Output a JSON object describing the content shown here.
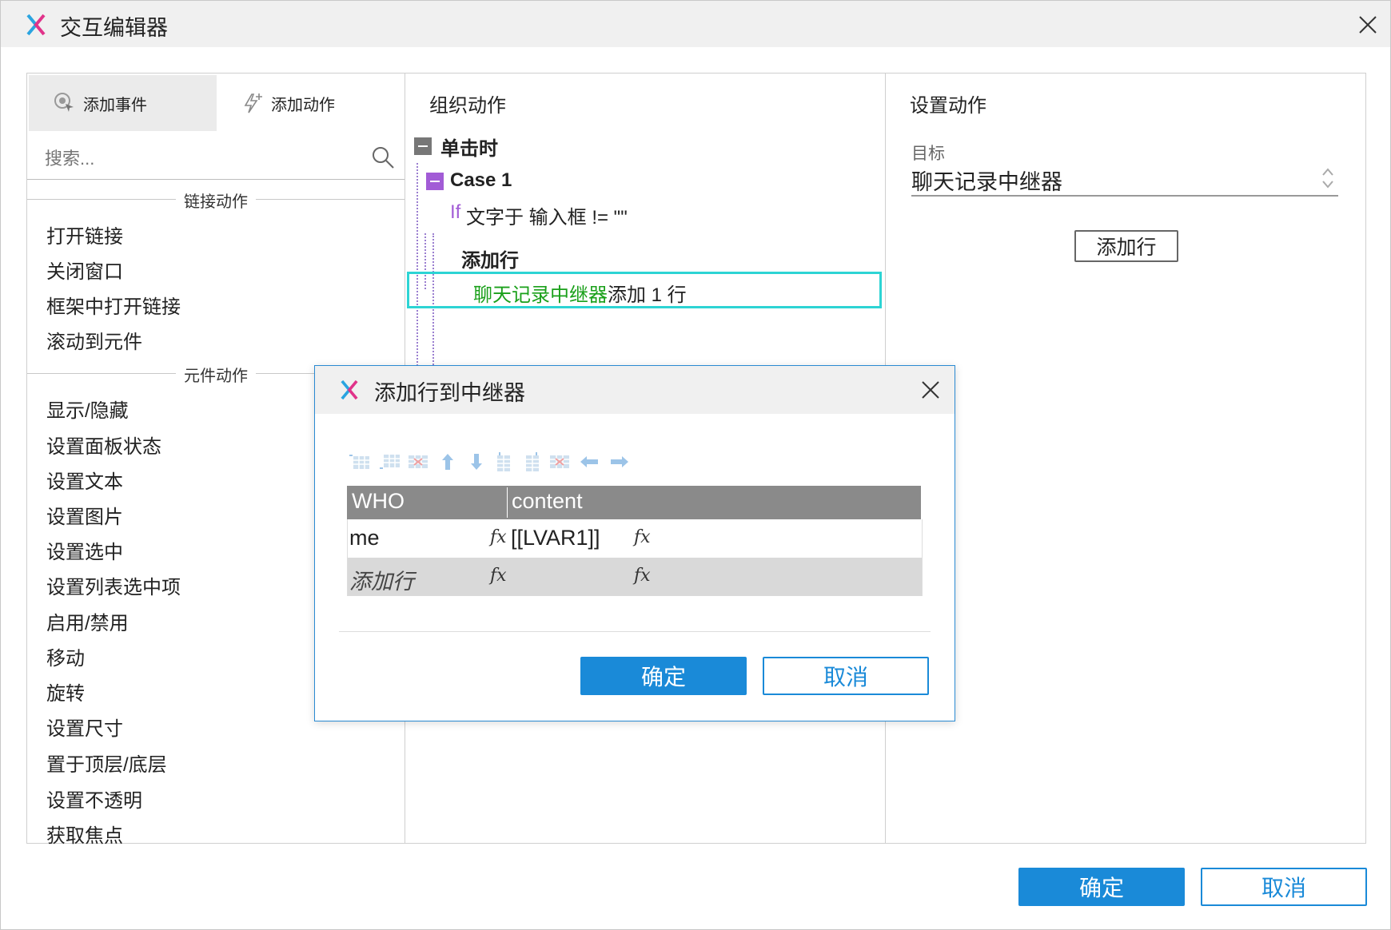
{
  "window": {
    "title": "交互编辑器"
  },
  "left_panel": {
    "tabs": [
      {
        "label": "添加事件"
      },
      {
        "label": "添加动作"
      }
    ],
    "search": {
      "placeholder": "搜索..."
    },
    "sections": [
      {
        "label": "链接动作",
        "items": [
          "打开链接",
          "关闭窗口",
          "框架中打开链接",
          "滚动到元件"
        ]
      },
      {
        "label": "元件动作",
        "items": [
          "显示/隐藏",
          "设置面板状态",
          "设置文本",
          "设置图片",
          "设置选中",
          "设置列表选中项",
          "启用/禁用",
          "移动",
          "旋转",
          "设置尺寸",
          "置于顶层/底层",
          "设置不透明",
          "获取焦点"
        ]
      }
    ]
  },
  "middle_panel": {
    "title": "组织动作",
    "event": "单击时",
    "case": "Case 1",
    "condition": {
      "if": "If",
      "text": "文字于 输入框 != \"\""
    },
    "action": "添加行",
    "action_detail": {
      "target": "聊天记录中继器",
      "rest": " 添加 1 行"
    }
  },
  "right_panel": {
    "title": "设置动作",
    "target_label": "目标",
    "target_value": "聊天记录中继器",
    "add_row_button": "添加行"
  },
  "dialog": {
    "title": "添加行到中继器",
    "columns": [
      "WHO",
      "content"
    ],
    "rows": [
      {
        "who": "me",
        "content": "[[LVAR1]]"
      },
      {
        "who": "添加行",
        "content": ""
      }
    ],
    "ok": "确定",
    "cancel": "取消"
  },
  "footer": {
    "ok": "确定",
    "cancel": "取消"
  },
  "colors": {
    "accent": "#1a8ad8",
    "selected_border": "#2dd4d4",
    "case_purple": "#a25cd6",
    "target_green": "#1aa01a"
  }
}
